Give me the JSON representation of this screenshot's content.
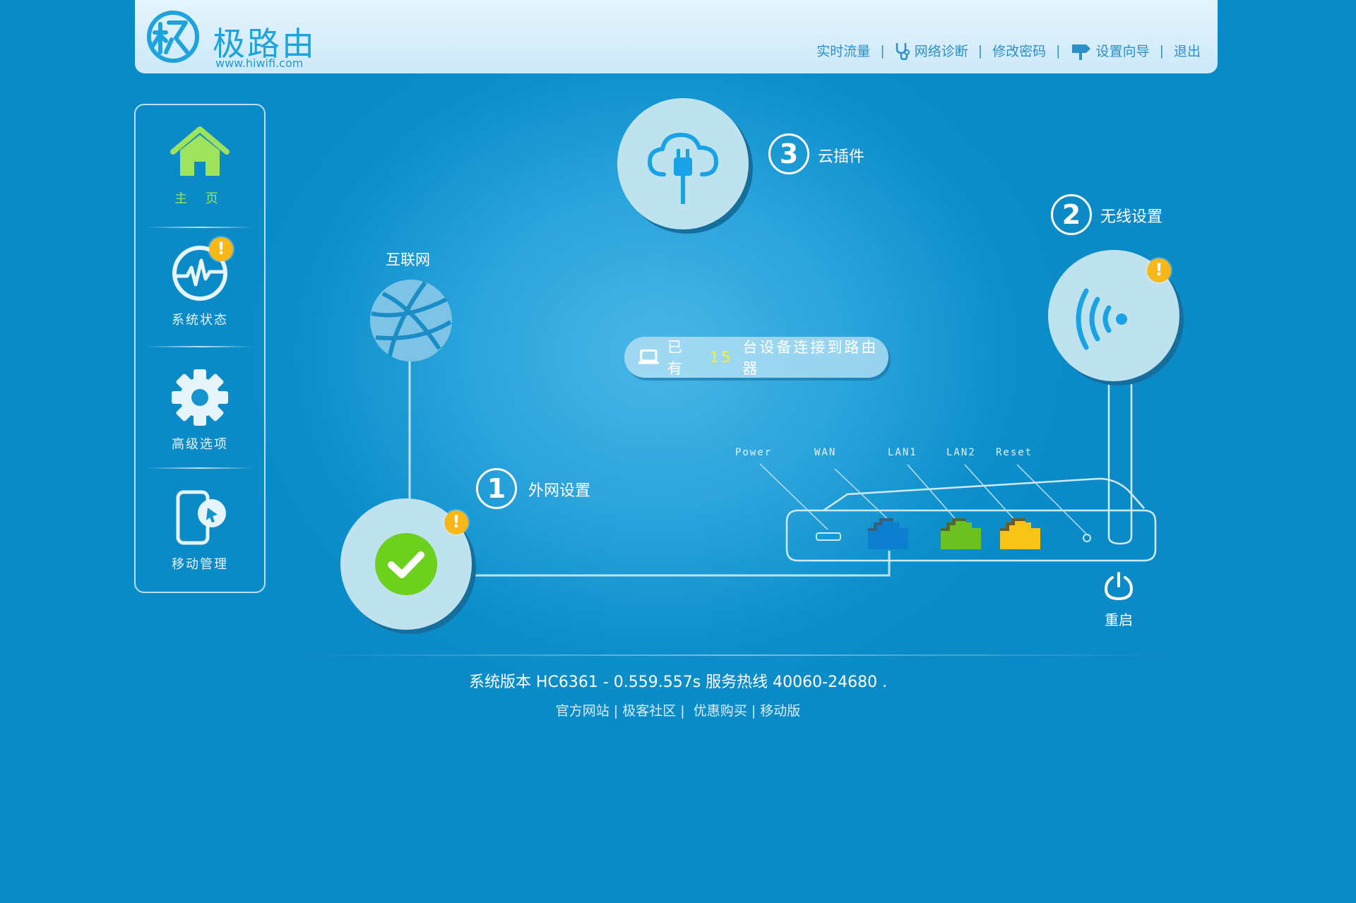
{
  "brand": {
    "name": "极路由",
    "url": "www.hiwifi.com"
  },
  "topnav": {
    "realtime_traffic": "实时流量",
    "network_diagnosis": "网络诊断",
    "change_password": "修改密码",
    "setup_wizard": "设置向导",
    "logout": "退出",
    "separator": "|"
  },
  "sidebar": {
    "items": [
      {
        "label": "主 页",
        "icon": "home-icon",
        "active": true
      },
      {
        "label": "系统状态",
        "icon": "activity-icon",
        "badge": "!"
      },
      {
        "label": "高级选项",
        "icon": "gear-icon"
      },
      {
        "label": "移动管理",
        "icon": "mobile-icon"
      }
    ]
  },
  "diagram": {
    "internet_label": "互联网",
    "step1": {
      "number": "1",
      "label": "外网设置",
      "badge": "!"
    },
    "step2": {
      "number": "2",
      "label": "无线设置",
      "badge": "!"
    },
    "step3": {
      "number": "3",
      "label": "云插件"
    },
    "devices": {
      "prefix": "已有",
      "count": "15",
      "suffix": "台设备连接到路由器"
    },
    "ports": {
      "power": "Power",
      "wan": "WAN",
      "lan1": "LAN1",
      "lan2": "LAN2",
      "reset": "Reset"
    },
    "reboot_label": "重启"
  },
  "colors": {
    "background": "#0a8ec9",
    "accent_green": "#9fe25b",
    "warning": "#f9b818",
    "wan_port": "#0d7fd0",
    "lan1_port": "#6cc01f",
    "lan2_port": "#f7c316",
    "count_highlight": "#f6f22c"
  },
  "footer": {
    "version_text": "系统版本 HC6361 - 0.559.557s 服务热线 40060-24680 .",
    "links": {
      "official": "官方网站",
      "community": "极客社区",
      "deals": "优惠购买",
      "mobile": "移动版"
    }
  }
}
